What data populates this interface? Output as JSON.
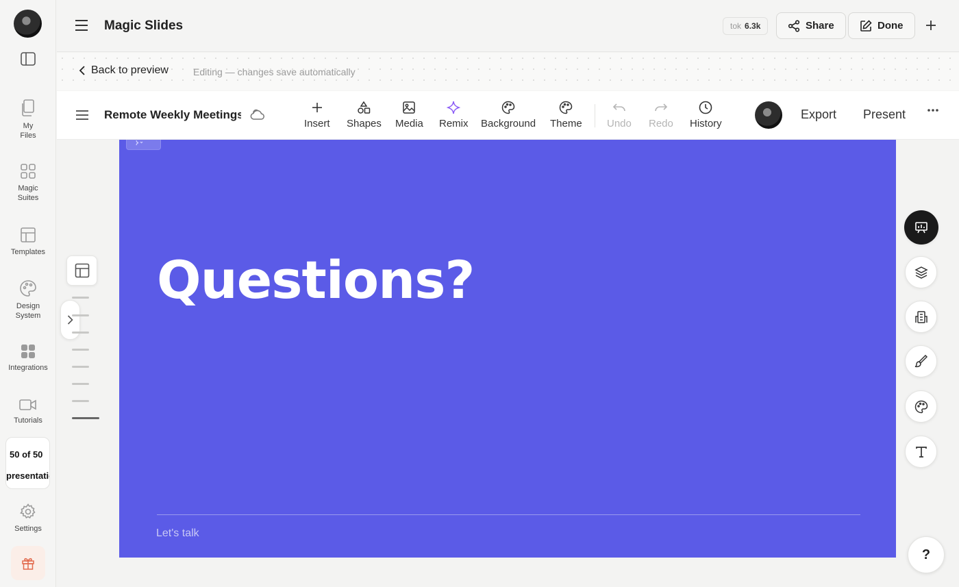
{
  "app": {
    "title": "Magic Slides"
  },
  "sidebar": {
    "items": [
      {
        "label": "My\nFiles",
        "icon": "file-copy-icon"
      },
      {
        "label": "Magic\nSuites",
        "icon": "grid-icon"
      },
      {
        "label": "Templates",
        "icon": "layout-template-icon"
      },
      {
        "label": "Design\nSystem",
        "icon": "palette-icon"
      },
      {
        "label": "Integrations",
        "icon": "apps-icon"
      },
      {
        "label": "Tutorials",
        "icon": "video-icon"
      },
      {
        "label": "Settings",
        "icon": "gear-icon"
      }
    ],
    "presentation_count_line1": "50 of 50",
    "presentation_count_line2": "presentations"
  },
  "header": {
    "token_key": "tok",
    "token_value": "6.3k",
    "share_label": "Share",
    "done_label": "Done"
  },
  "edit_strip": {
    "back_label": "Back to preview",
    "hint": "Editing — changes save automatically"
  },
  "toolbar": {
    "doc_title": "Remote Weekly Meetings",
    "tools": {
      "insert": "Insert",
      "shapes": "Shapes",
      "media": "Media",
      "remix": "Remix",
      "background": "Background",
      "theme": "Theme",
      "undo": "Undo",
      "redo": "Redo",
      "history": "History"
    },
    "export_label": "Export",
    "present_label": "Present"
  },
  "slide": {
    "headline": "Questions?",
    "footer": "Let's talk",
    "background_color": "#5b5be7"
  },
  "slide_nav": {
    "slide_count": 8,
    "current_slide": 8
  },
  "help_label": "?",
  "colors": {
    "accent": "#5b5be7",
    "remix": "#8b5cf6",
    "gift": "#e26a4d"
  }
}
